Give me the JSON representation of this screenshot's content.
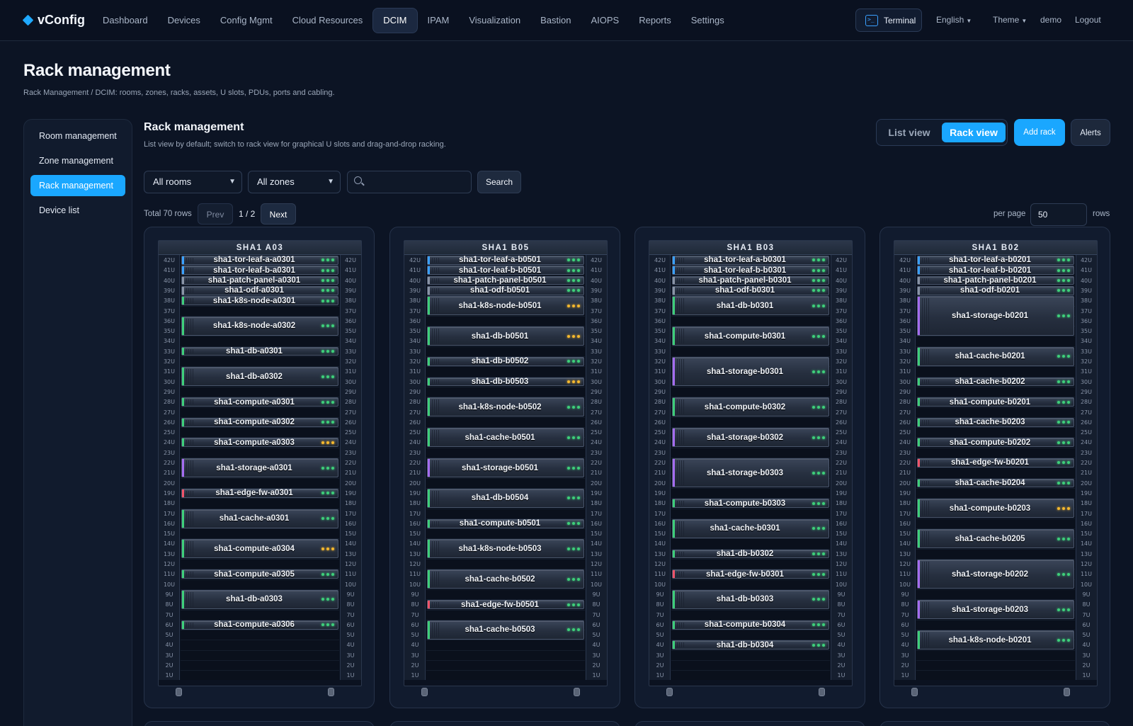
{
  "brand": {
    "name": "vConfig"
  },
  "nav": {
    "items": [
      {
        "label": "Dashboard",
        "active": false
      },
      {
        "label": "Devices",
        "active": false
      },
      {
        "label": "Config Mgmt",
        "active": false
      },
      {
        "label": "Cloud Resources",
        "active": false
      },
      {
        "label": "DCIM",
        "active": true
      },
      {
        "label": "IPAM",
        "active": false
      },
      {
        "label": "Visualization",
        "active": false
      },
      {
        "label": "Bastion",
        "active": false
      },
      {
        "label": "AIOPS",
        "active": false
      },
      {
        "label": "Reports",
        "active": false
      },
      {
        "label": "Settings",
        "active": false
      }
    ],
    "terminal_label": "Terminal",
    "language": "English",
    "theme": "Theme",
    "user": "demo",
    "logout": "Logout"
  },
  "page": {
    "title": "Rack management",
    "breadcrumb": "Rack Management / DCIM: rooms, zones, racks, assets, U slots, PDUs, ports and cabling."
  },
  "sidebar": {
    "items": [
      {
        "label": "Room management",
        "active": false
      },
      {
        "label": "Zone management",
        "active": false
      },
      {
        "label": "Rack management",
        "active": true
      },
      {
        "label": "Device list",
        "active": false
      }
    ]
  },
  "main": {
    "title": "Rack management",
    "description": "List view by default; switch to rack view for graphical U slots and drag-and-drop racking.",
    "view_list": "List view",
    "view_rack": "Rack view",
    "active_view": "Rack view",
    "add_rack": "Add rack",
    "alerts": "Alerts"
  },
  "filters": {
    "room": "All rooms",
    "zone": "All zones",
    "search_value": "",
    "search_button": "Search"
  },
  "pagination": {
    "total": "Total 70 rows",
    "prev": "Prev",
    "page": "1 / 2",
    "next": "Next",
    "per_page_label": "per page",
    "per_page": "50",
    "rows_label": "rows"
  },
  "colors": {
    "accent": "#1aa7ff",
    "led_ok": "#3ecf7a",
    "led_warn": "#f5b82e",
    "stripe_network": "#3aa0ff",
    "stripe_passive": "#8a94a6",
    "stripe_compute": "#3ecf7a",
    "stripe_storage": "#a56cf0",
    "stripe_firewall": "#f0546a"
  },
  "racks": [
    {
      "name": "SHA1 A03",
      "devices": [
        {
          "name": "sha1-tor-leaf-a-a0301",
          "top_u": 42,
          "height_u": 1,
          "kind": "network",
          "status": "ok"
        },
        {
          "name": "sha1-tor-leaf-b-a0301",
          "top_u": 41,
          "height_u": 1,
          "kind": "network",
          "status": "ok"
        },
        {
          "name": "sha1-patch-panel-a0301",
          "top_u": 40,
          "height_u": 1,
          "kind": "passive",
          "status": "ok"
        },
        {
          "name": "sha1-odf-a0301",
          "top_u": 39,
          "height_u": 1,
          "kind": "passive",
          "status": "ok"
        },
        {
          "name": "sha1-k8s-node-a0301",
          "top_u": 38,
          "height_u": 1,
          "kind": "compute",
          "status": "ok"
        },
        {
          "name": "sha1-k8s-node-a0302",
          "top_u": 36,
          "height_u": 2,
          "kind": "compute",
          "status": "ok"
        },
        {
          "name": "sha1-db-a0301",
          "top_u": 33,
          "height_u": 1,
          "kind": "compute",
          "status": "ok"
        },
        {
          "name": "sha1-db-a0302",
          "top_u": 31,
          "height_u": 2,
          "kind": "compute",
          "status": "ok"
        },
        {
          "name": "sha1-compute-a0301",
          "top_u": 28,
          "height_u": 1,
          "kind": "compute",
          "status": "ok"
        },
        {
          "name": "sha1-compute-a0302",
          "top_u": 26,
          "height_u": 1,
          "kind": "compute",
          "status": "ok"
        },
        {
          "name": "sha1-compute-a0303",
          "top_u": 24,
          "height_u": 1,
          "kind": "compute",
          "status": "warn"
        },
        {
          "name": "sha1-storage-a0301",
          "top_u": 22,
          "height_u": 2,
          "kind": "storage",
          "status": "ok"
        },
        {
          "name": "sha1-edge-fw-a0301",
          "top_u": 19,
          "height_u": 1,
          "kind": "firewall",
          "status": "ok"
        },
        {
          "name": "sha1-cache-a0301",
          "top_u": 17,
          "height_u": 2,
          "kind": "compute",
          "status": "ok"
        },
        {
          "name": "sha1-compute-a0304",
          "top_u": 14,
          "height_u": 2,
          "kind": "compute",
          "status": "warn"
        },
        {
          "name": "sha1-compute-a0305",
          "top_u": 11,
          "height_u": 1,
          "kind": "compute",
          "status": "ok"
        },
        {
          "name": "sha1-db-a0303",
          "top_u": 9,
          "height_u": 2,
          "kind": "compute",
          "status": "ok"
        },
        {
          "name": "sha1-compute-a0306",
          "top_u": 6,
          "height_u": 1,
          "kind": "compute",
          "status": "ok"
        }
      ]
    },
    {
      "name": "SHA1 B05",
      "devices": [
        {
          "name": "sha1-tor-leaf-a-b0501",
          "top_u": 42,
          "height_u": 1,
          "kind": "network",
          "status": "ok"
        },
        {
          "name": "sha1-tor-leaf-b-b0501",
          "top_u": 41,
          "height_u": 1,
          "kind": "network",
          "status": "ok"
        },
        {
          "name": "sha1-patch-panel-b0501",
          "top_u": 40,
          "height_u": 1,
          "kind": "passive",
          "status": "ok"
        },
        {
          "name": "sha1-odf-b0501",
          "top_u": 39,
          "height_u": 1,
          "kind": "passive",
          "status": "ok"
        },
        {
          "name": "sha1-k8s-node-b0501",
          "top_u": 38,
          "height_u": 2,
          "kind": "compute",
          "status": "warn"
        },
        {
          "name": "sha1-db-b0501",
          "top_u": 35,
          "height_u": 2,
          "kind": "compute",
          "status": "warn"
        },
        {
          "name": "sha1-db-b0502",
          "top_u": 32,
          "height_u": 1,
          "kind": "compute",
          "status": "ok"
        },
        {
          "name": "sha1-db-b0503",
          "top_u": 30,
          "height_u": 1,
          "kind": "compute",
          "status": "warn"
        },
        {
          "name": "sha1-k8s-node-b0502",
          "top_u": 28,
          "height_u": 2,
          "kind": "compute",
          "status": "ok"
        },
        {
          "name": "sha1-cache-b0501",
          "top_u": 25,
          "height_u": 2,
          "kind": "compute",
          "status": "ok"
        },
        {
          "name": "sha1-storage-b0501",
          "top_u": 22,
          "height_u": 2,
          "kind": "storage",
          "status": "ok"
        },
        {
          "name": "sha1-db-b0504",
          "top_u": 19,
          "height_u": 2,
          "kind": "compute",
          "status": "ok"
        },
        {
          "name": "sha1-compute-b0501",
          "top_u": 16,
          "height_u": 1,
          "kind": "compute",
          "status": "ok"
        },
        {
          "name": "sha1-k8s-node-b0503",
          "top_u": 14,
          "height_u": 2,
          "kind": "compute",
          "status": "ok"
        },
        {
          "name": "sha1-cache-b0502",
          "top_u": 11,
          "height_u": 2,
          "kind": "compute",
          "status": "ok"
        },
        {
          "name": "sha1-edge-fw-b0501",
          "top_u": 8,
          "height_u": 1,
          "kind": "firewall",
          "status": "ok"
        },
        {
          "name": "sha1-cache-b0503",
          "top_u": 6,
          "height_u": 2,
          "kind": "compute",
          "status": "ok"
        }
      ]
    },
    {
      "name": "SHA1 B03",
      "devices": [
        {
          "name": "sha1-tor-leaf-a-b0301",
          "top_u": 42,
          "height_u": 1,
          "kind": "network",
          "status": "ok"
        },
        {
          "name": "sha1-tor-leaf-b-b0301",
          "top_u": 41,
          "height_u": 1,
          "kind": "network",
          "status": "ok"
        },
        {
          "name": "sha1-patch-panel-b0301",
          "top_u": 40,
          "height_u": 1,
          "kind": "passive",
          "status": "ok"
        },
        {
          "name": "sha1-odf-b0301",
          "top_u": 39,
          "height_u": 1,
          "kind": "passive",
          "status": "ok"
        },
        {
          "name": "sha1-db-b0301",
          "top_u": 38,
          "height_u": 2,
          "kind": "compute",
          "status": "ok"
        },
        {
          "name": "sha1-compute-b0301",
          "top_u": 35,
          "height_u": 2,
          "kind": "compute",
          "status": "ok"
        },
        {
          "name": "sha1-storage-b0301",
          "top_u": 32,
          "height_u": 3,
          "kind": "storage",
          "status": "ok"
        },
        {
          "name": "sha1-compute-b0302",
          "top_u": 28,
          "height_u": 2,
          "kind": "compute",
          "status": "ok"
        },
        {
          "name": "sha1-storage-b0302",
          "top_u": 25,
          "height_u": 2,
          "kind": "storage",
          "status": "ok"
        },
        {
          "name": "sha1-storage-b0303",
          "top_u": 22,
          "height_u": 3,
          "kind": "storage",
          "status": "ok"
        },
        {
          "name": "sha1-compute-b0303",
          "top_u": 18,
          "height_u": 1,
          "kind": "compute",
          "status": "ok"
        },
        {
          "name": "sha1-cache-b0301",
          "top_u": 16,
          "height_u": 2,
          "kind": "compute",
          "status": "ok"
        },
        {
          "name": "sha1-db-b0302",
          "top_u": 13,
          "height_u": 1,
          "kind": "compute",
          "status": "ok"
        },
        {
          "name": "sha1-edge-fw-b0301",
          "top_u": 11,
          "height_u": 1,
          "kind": "firewall",
          "status": "ok"
        },
        {
          "name": "sha1-db-b0303",
          "top_u": 9,
          "height_u": 2,
          "kind": "compute",
          "status": "ok"
        },
        {
          "name": "sha1-compute-b0304",
          "top_u": 6,
          "height_u": 1,
          "kind": "compute",
          "status": "ok"
        },
        {
          "name": "sha1-db-b0304",
          "top_u": 4,
          "height_u": 1,
          "kind": "compute",
          "status": "ok"
        }
      ]
    },
    {
      "name": "SHA1 B02",
      "devices": [
        {
          "name": "sha1-tor-leaf-a-b0201",
          "top_u": 42,
          "height_u": 1,
          "kind": "network",
          "status": "ok"
        },
        {
          "name": "sha1-tor-leaf-b-b0201",
          "top_u": 41,
          "height_u": 1,
          "kind": "network",
          "status": "ok"
        },
        {
          "name": "sha1-patch-panel-b0201",
          "top_u": 40,
          "height_u": 1,
          "kind": "passive",
          "status": "ok"
        },
        {
          "name": "sha1-odf-b0201",
          "top_u": 39,
          "height_u": 1,
          "kind": "passive",
          "status": "ok"
        },
        {
          "name": "sha1-storage-b0201",
          "top_u": 38,
          "height_u": 4,
          "kind": "storage",
          "status": "ok"
        },
        {
          "name": "sha1-cache-b0201",
          "top_u": 33,
          "height_u": 2,
          "kind": "compute",
          "status": "ok"
        },
        {
          "name": "sha1-cache-b0202",
          "top_u": 30,
          "height_u": 1,
          "kind": "compute",
          "status": "ok"
        },
        {
          "name": "sha1-compute-b0201",
          "top_u": 28,
          "height_u": 1,
          "kind": "compute",
          "status": "ok"
        },
        {
          "name": "sha1-cache-b0203",
          "top_u": 26,
          "height_u": 1,
          "kind": "compute",
          "status": "ok"
        },
        {
          "name": "sha1-compute-b0202",
          "top_u": 24,
          "height_u": 1,
          "kind": "compute",
          "status": "ok"
        },
        {
          "name": "sha1-edge-fw-b0201",
          "top_u": 22,
          "height_u": 1,
          "kind": "firewall",
          "status": "ok"
        },
        {
          "name": "sha1-cache-b0204",
          "top_u": 20,
          "height_u": 1,
          "kind": "compute",
          "status": "ok"
        },
        {
          "name": "sha1-compute-b0203",
          "top_u": 18,
          "height_u": 2,
          "kind": "compute",
          "status": "warn"
        },
        {
          "name": "sha1-cache-b0205",
          "top_u": 15,
          "height_u": 2,
          "kind": "compute",
          "status": "ok"
        },
        {
          "name": "sha1-storage-b0202",
          "top_u": 12,
          "height_u": 3,
          "kind": "storage",
          "status": "ok"
        },
        {
          "name": "sha1-storage-b0203",
          "top_u": 8,
          "height_u": 2,
          "kind": "storage",
          "status": "ok"
        },
        {
          "name": "sha1-k8s-node-b0201",
          "top_u": 5,
          "height_u": 2,
          "kind": "compute",
          "status": "ok"
        }
      ]
    }
  ]
}
